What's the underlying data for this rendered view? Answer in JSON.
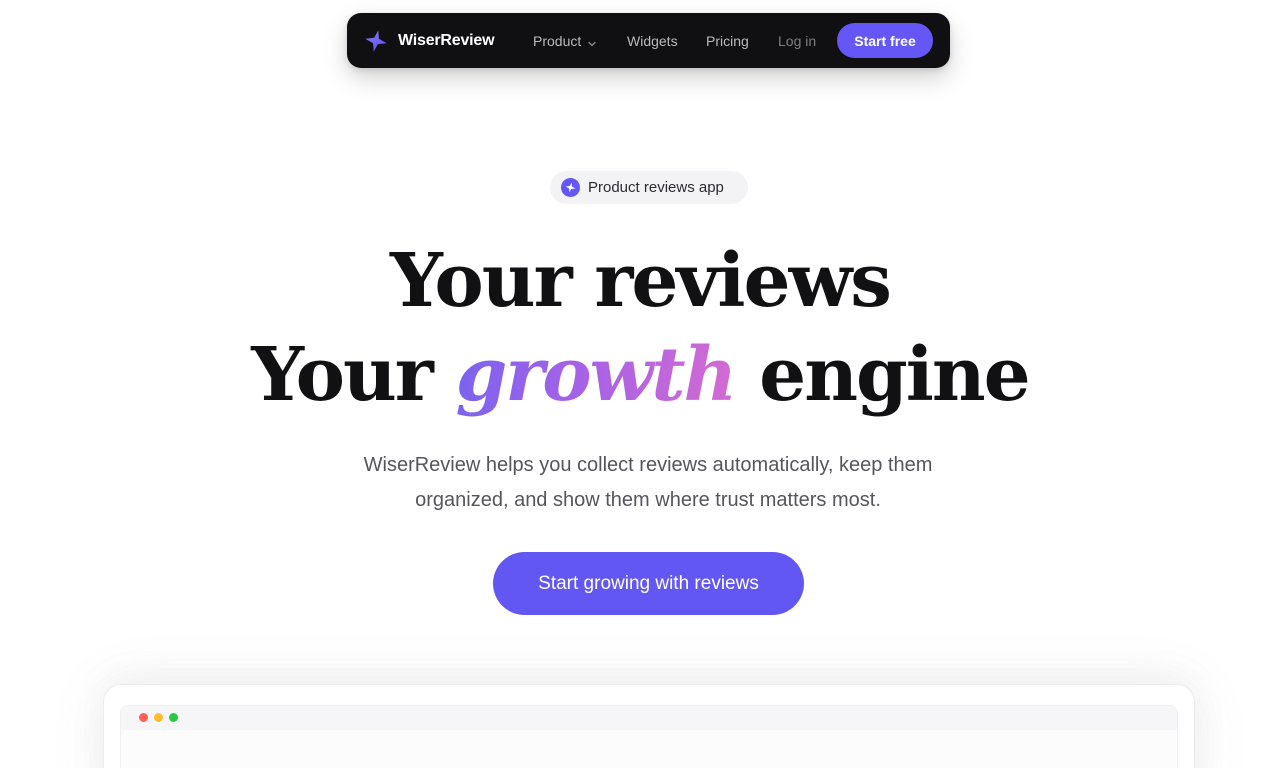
{
  "navbar": {
    "brand_name": "WiserReview",
    "brand_icon": "wiserreview-star-logo-icon",
    "items": [
      {
        "label": "Product",
        "has_dropdown": true
      },
      {
        "label": "Widgets"
      },
      {
        "label": "Pricing"
      },
      {
        "label": "Log in"
      }
    ],
    "cta_label": "Start free"
  },
  "hero": {
    "badge_label": "Product reviews app",
    "badge_icon": "star-badge-icon",
    "headline_line1": "Your reviews",
    "headline_line2_pre": "Your ",
    "headline_line2_accent": "growth",
    "headline_line2_post": " engine",
    "subtext_line1": "WiserReview helps you collect reviews automatically, keep them",
    "subtext_line2": "organized, and show them where trust matters most.",
    "cta_label": "Start growing with reviews"
  },
  "preview": {
    "window_controls": [
      "red-dot",
      "yellow-dot",
      "green-dot"
    ]
  },
  "colors": {
    "accent": "#6557f5",
    "nav_bg": "#101012",
    "gradient_start": "#7c63f0",
    "gradient_end": "#d46ad2"
  }
}
